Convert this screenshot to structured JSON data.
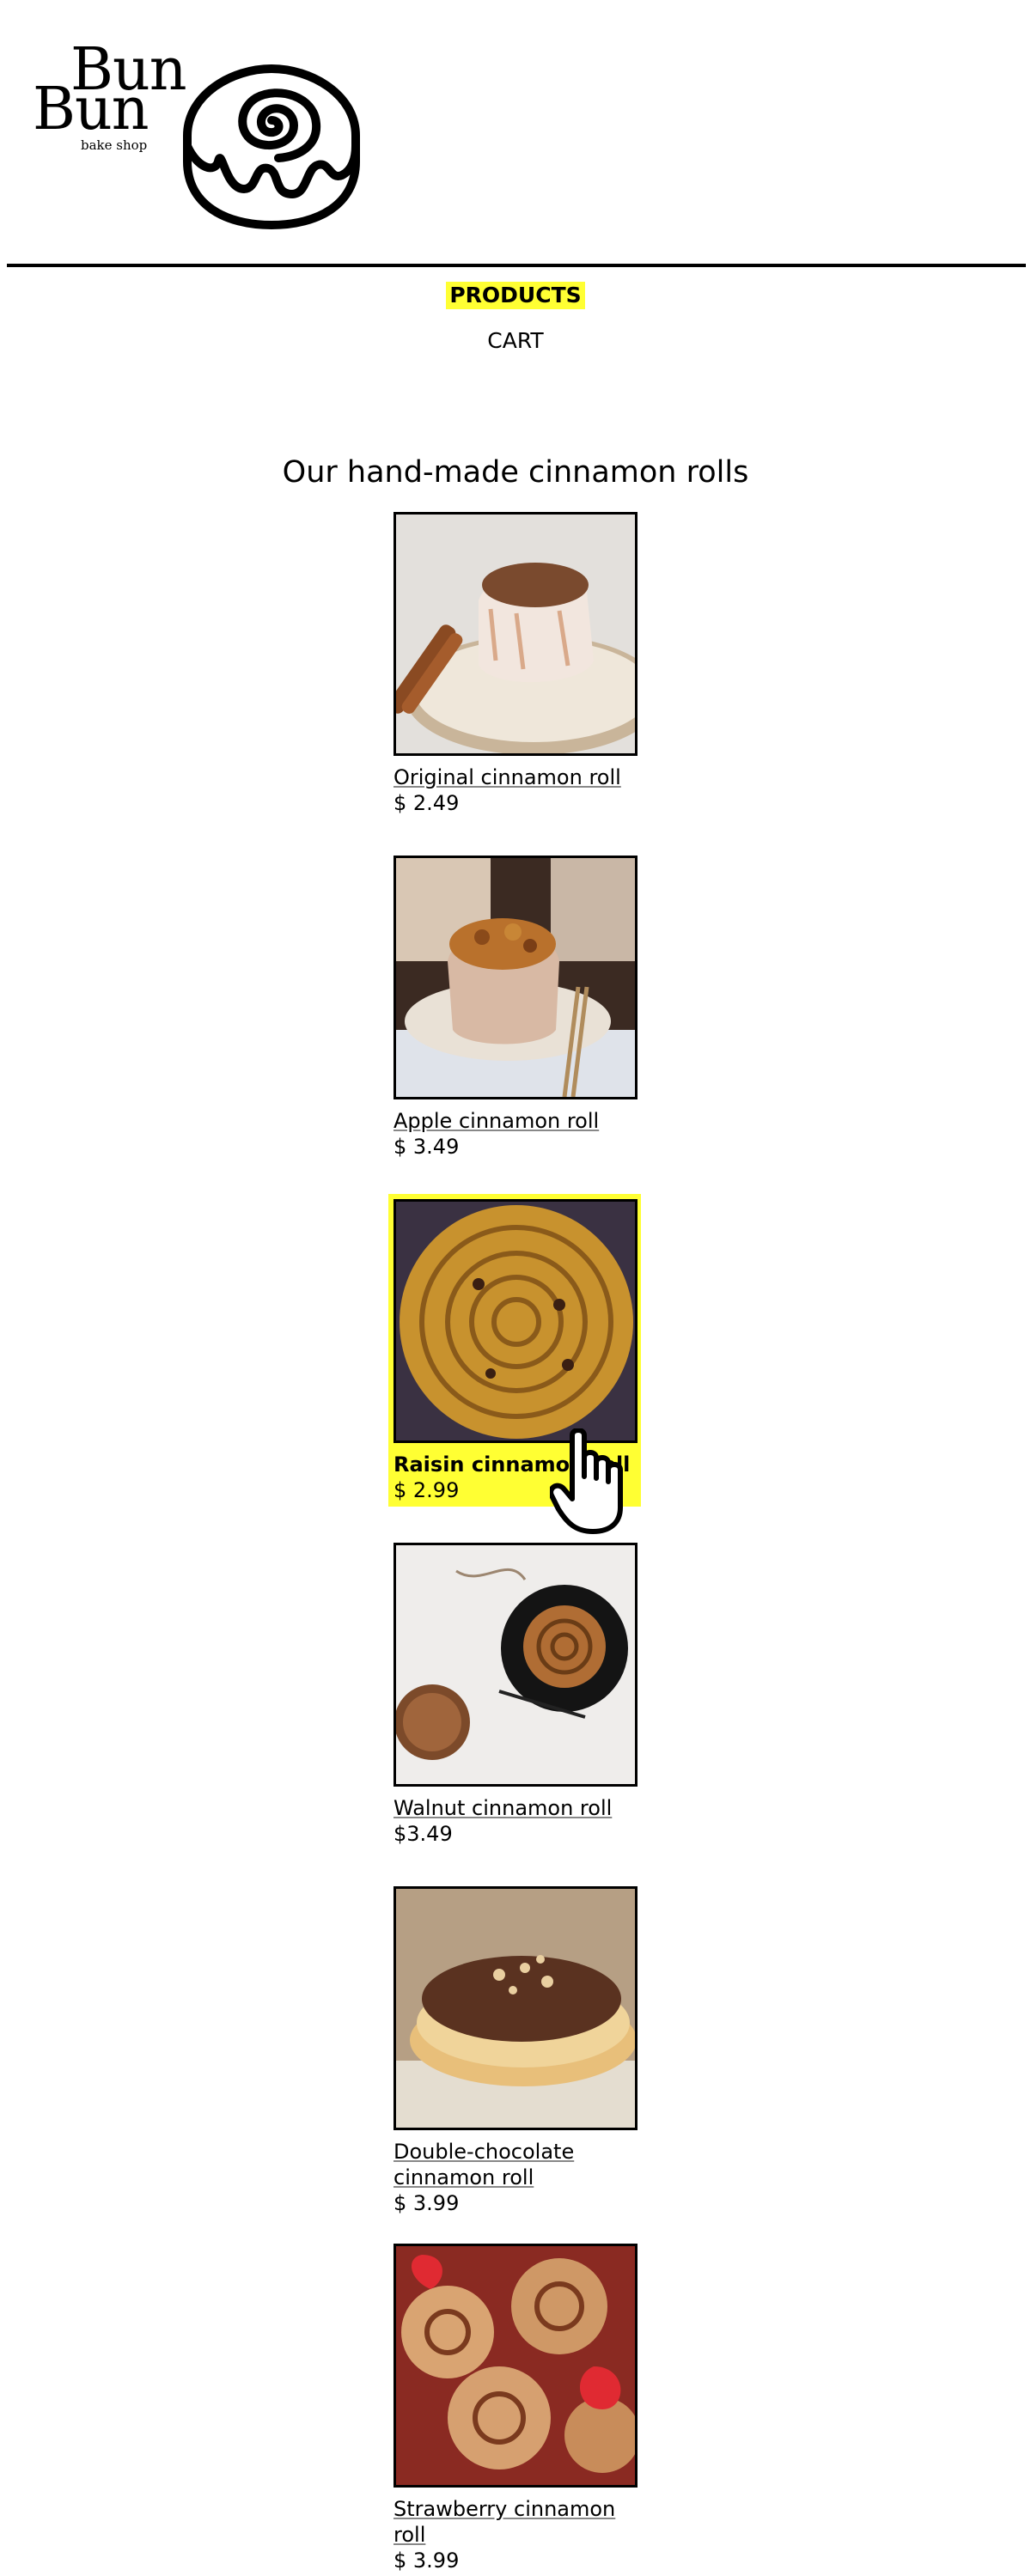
{
  "brand": {
    "line1": "Bun",
    "line2": "Bun",
    "tagline": "bake shop"
  },
  "nav": {
    "products": "PRODUCTS",
    "cart": "CART"
  },
  "heading": "Our hand-made cinnamon rolls",
  "colors": {
    "highlight": "#ffff33",
    "text": "#000000",
    "background": "#ffffff"
  },
  "products": [
    {
      "name": "Original cinnamon roll",
      "price": "$ 2.49",
      "image": "iced-cinnamon-roll-with-stick"
    },
    {
      "name": "Apple cinnamon roll",
      "price": "$ 3.49",
      "image": "apple-cinnamon-roll-on-plate"
    },
    {
      "name": "Raisin cinnamon roll",
      "price": "$ 2.99",
      "image": "raisin-swirl-pastry",
      "hovered": true
    },
    {
      "name": "Walnut cinnamon roll",
      "price": "$3.49",
      "image": "walnut-roll-on-black-plate"
    },
    {
      "name": "Double-chocolate cinnamon roll",
      "price": "$ 3.99",
      "image": "chocolate-glazed-roll"
    },
    {
      "name": "Strawberry cinnamon roll",
      "price": "$ 3.99",
      "image": "strawberry-roll-pops"
    }
  ],
  "cursor": "hand-pointer-icon"
}
